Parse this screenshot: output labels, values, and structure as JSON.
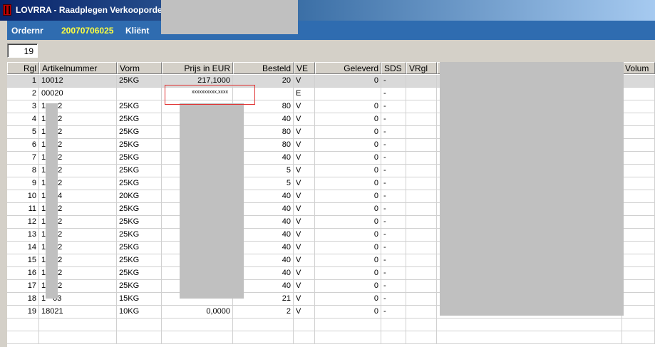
{
  "window": {
    "title": "LOVRRA - Raadplegen Verkooporder"
  },
  "header": {
    "order_label": "Ordernr",
    "order_value": "20070706025",
    "client_label": "Kliënt"
  },
  "counter": "19",
  "columns": [
    "Rgl",
    "Artikelnummer",
    "Vorm",
    "Prijs in EUR",
    "Besteld",
    "VE",
    "Geleverd",
    "SDS",
    "VRgl",
    "Volum"
  ],
  "rows": [
    {
      "rgl": "1",
      "art": "10012",
      "vorm": "25KG",
      "prijs": "217,1000",
      "besteld": "20",
      "ve": "V",
      "geleverd": "0",
      "sds": "-"
    },
    {
      "rgl": "2",
      "art": "00020",
      "vorm": "",
      "prijs": "",
      "besteld": "",
      "ve": "E",
      "geleverd": "",
      "sds": "-"
    },
    {
      "rgl": "3",
      "art": "1",
      "art2": "2",
      "vorm": "25KG",
      "prijs": "",
      "besteld": "80",
      "ve": "V",
      "geleverd": "0",
      "sds": "-"
    },
    {
      "rgl": "4",
      "art": "1",
      "art2": "2",
      "vorm": "25KG",
      "prijs": "",
      "besteld": "40",
      "ve": "V",
      "geleverd": "0",
      "sds": "-"
    },
    {
      "rgl": "5",
      "art": "1",
      "art2": "2",
      "vorm": "25KG",
      "prijs": "",
      "besteld": "80",
      "ve": "V",
      "geleverd": "0",
      "sds": "-"
    },
    {
      "rgl": "6",
      "art": "1",
      "art2": "2",
      "vorm": "25KG",
      "prijs": "",
      "besteld": "80",
      "ve": "V",
      "geleverd": "0",
      "sds": "-"
    },
    {
      "rgl": "7",
      "art": "1",
      "art2": "2",
      "vorm": "25KG",
      "prijs": "",
      "besteld": "40",
      "ve": "V",
      "geleverd": "0",
      "sds": "-"
    },
    {
      "rgl": "8",
      "art": "1",
      "art2": "2",
      "vorm": "25KG",
      "prijs": "",
      "besteld": "5",
      "ve": "V",
      "geleverd": "0",
      "sds": "-"
    },
    {
      "rgl": "9",
      "art": "1",
      "art2": "2",
      "vorm": "25KG",
      "prijs": "",
      "besteld": "5",
      "ve": "V",
      "geleverd": "0",
      "sds": "-"
    },
    {
      "rgl": "10",
      "art": "1",
      "art2": "4",
      "vorm": "20KG",
      "prijs": "",
      "besteld": "40",
      "ve": "V",
      "geleverd": "0",
      "sds": "-"
    },
    {
      "rgl": "11",
      "art": "1",
      "art2": "2",
      "vorm": "25KG",
      "prijs": "",
      "besteld": "40",
      "ve": "V",
      "geleverd": "0",
      "sds": "-"
    },
    {
      "rgl": "12",
      "art": "1",
      "art2": "2",
      "vorm": "25KG",
      "prijs": "",
      "besteld": "40",
      "ve": "V",
      "geleverd": "0",
      "sds": "-"
    },
    {
      "rgl": "13",
      "art": "1",
      "art2": "2",
      "vorm": "25KG",
      "prijs": "",
      "besteld": "40",
      "ve": "V",
      "geleverd": "0",
      "sds": "-"
    },
    {
      "rgl": "14",
      "art": "1",
      "art2": "2",
      "vorm": "25KG",
      "prijs": "",
      "besteld": "40",
      "ve": "V",
      "geleverd": "0",
      "sds": "-"
    },
    {
      "rgl": "15",
      "art": "1",
      "art2": "2",
      "vorm": "25KG",
      "prijs": "",
      "besteld": "40",
      "ve": "V",
      "geleverd": "0",
      "sds": "-"
    },
    {
      "rgl": "16",
      "art": "1",
      "art2": "2",
      "vorm": "25KG",
      "prijs": "",
      "besteld": "40",
      "ve": "V",
      "geleverd": "0",
      "sds": "-"
    },
    {
      "rgl": "17",
      "art": "1",
      "art2": "2",
      "vorm": "25KG",
      "prijs": "",
      "besteld": "40",
      "ve": "V",
      "geleverd": "0",
      "sds": "-"
    },
    {
      "rgl": "18",
      "art": "1",
      "art2": "03",
      "vorm": "15KG",
      "prijs": "",
      "besteld": "21",
      "ve": "V",
      "geleverd": "0",
      "sds": "-"
    },
    {
      "rgl": "19",
      "art": "18021",
      "vorm": "10KG",
      "prijs": "0,0000",
      "besteld": "2",
      "ve": "V",
      "geleverd": "0",
      "sds": "-"
    }
  ],
  "editing_cell_text": "xxxxxxxxxx,xxxx",
  "colors": {
    "header_bar": "#2f6cb0",
    "order_number": "#ffff40",
    "edit_border": "#e03030",
    "redaction": "#c0c0c0"
  }
}
